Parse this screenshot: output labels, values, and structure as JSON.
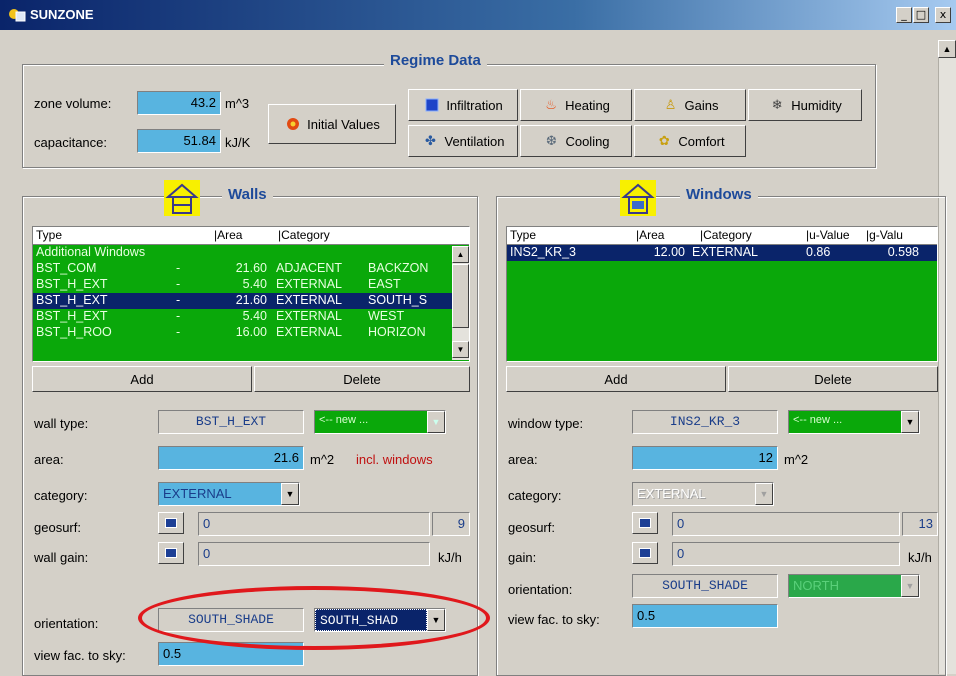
{
  "window": {
    "title": "SUNZONE",
    "min": "_",
    "max": "□",
    "close": "x"
  },
  "regime": {
    "title": "Regime Data",
    "zone_volume_label": "zone volume:",
    "zone_volume": "43.2",
    "zone_volume_unit": "m^3",
    "capacitance_label": "capacitance:",
    "capacitance": "51.84",
    "capacitance_unit": "kJ/K",
    "initial_values": "Initial Values",
    "buttons": {
      "infiltration": "Infiltration",
      "heating": "Heating",
      "gains": "Gains",
      "humidity": "Humidity",
      "ventilation": "Ventilation",
      "cooling": "Cooling",
      "comfort": "Comfort"
    }
  },
  "walls": {
    "title": "Walls",
    "columns": [
      "Type",
      "|Area",
      "|Category"
    ],
    "rows": [
      {
        "type": "Additional Windows",
        "dot": "",
        "area": "",
        "category": "",
        "zone": ""
      },
      {
        "type": "BST_COM",
        "dot": "-",
        "area": "21.60",
        "category": "ADJACENT",
        "zone": "BACKZON"
      },
      {
        "type": "BST_H_EXT",
        "dot": "-",
        "area": "5.40",
        "category": "EXTERNAL",
        "zone": "EAST"
      },
      {
        "type": "BST_H_EXT",
        "dot": "-",
        "area": "21.60",
        "category": "EXTERNAL",
        "zone": "SOUTH_S"
      },
      {
        "type": "BST_H_EXT",
        "dot": "-",
        "area": "5.40",
        "category": "EXTERNAL",
        "zone": "WEST"
      },
      {
        "type": "BST_H_ROO",
        "dot": "-",
        "area": "16.00",
        "category": "EXTERNAL",
        "zone": "HORIZON"
      }
    ],
    "add": "Add",
    "delete": "Delete",
    "wall_type_label": "wall type:",
    "wall_type": "BST_H_EXT",
    "new_option": "<-- new ...",
    "area_label": "area:",
    "area": "21.6",
    "area_unit": "m^2",
    "incl_windows": "incl. windows",
    "category_label": "category:",
    "category": "EXTERNAL",
    "geosurf_label": "geosurf:",
    "geosurf": "0",
    "geosurf_count": "9",
    "wall_gain_label": "wall gain:",
    "wall_gain": "0",
    "wall_gain_unit": "kJ/h",
    "orientation_label": "orientation:",
    "orientation": "SOUTH_SHADE",
    "orientation_select": "SOUTH_SHAD",
    "view_fac_label": "view fac. to sky:",
    "view_fac": "0.5"
  },
  "windows": {
    "title": "Windows",
    "columns": [
      "Type",
      "|Area",
      "|Category",
      "|u-Value",
      "|g-Valu"
    ],
    "rows": [
      {
        "type": "INS2_KR_3",
        "area": "12.00",
        "category": "EXTERNAL",
        "u": "0.86",
        "g": "0.598"
      }
    ],
    "add": "Add",
    "delete": "Delete",
    "window_type_label": "window type:",
    "window_type": "INS2_KR_3",
    "new_option": "<-- new ...",
    "area_label": "area:",
    "area": "12",
    "area_unit": "m^2",
    "category_label": "category:",
    "category": "EXTERNAL",
    "geosurf_label": "geosurf:",
    "geosurf": "0",
    "geosurf_count": "13",
    "gain_label": "gain:",
    "gain": "0",
    "gain_unit": "kJ/h",
    "orientation_label": "orientation:",
    "orientation": "SOUTH_SHADE",
    "orientation_select": "NORTH",
    "view_fac_label": "view fac. to sky:",
    "view_fac": "0.5"
  },
  "colors": {
    "list_green": "#0aa80a",
    "field_blue": "#58b4e0",
    "title_blue": "#0a246a",
    "highlight_red": "#e0181c"
  }
}
